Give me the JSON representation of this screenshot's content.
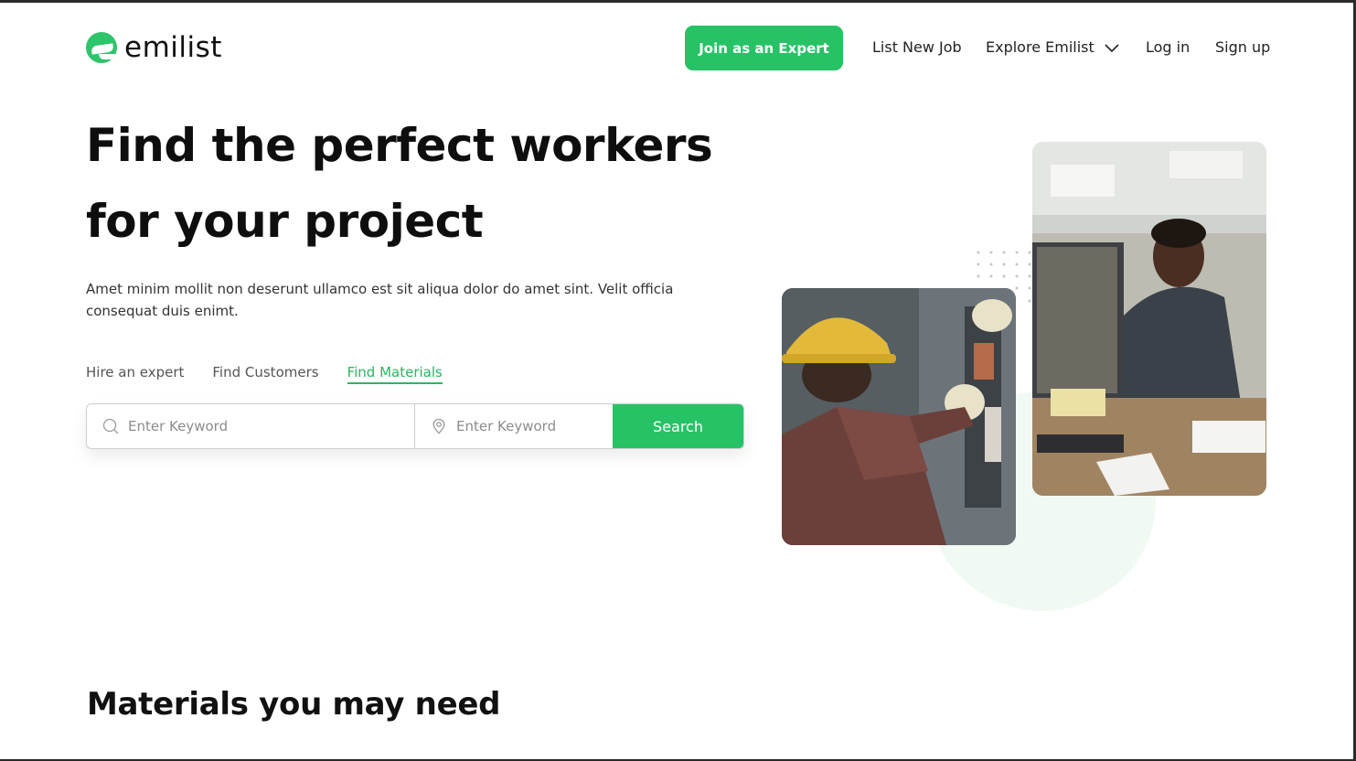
{
  "header": {
    "logo_text": "emilist",
    "join_label": "Join as an Expert",
    "nav": {
      "list_new_job": "List New Job",
      "explore": "Explore Emilist",
      "login": "Log in",
      "signup": "Sign up"
    }
  },
  "hero": {
    "title": "Find the perfect workers for your project",
    "description": "Amet minim mollit non deserunt ullamco est sit aliqua dolor do amet sint. Velit officia consequat duis enimt.",
    "tabs": [
      {
        "label": "Hire an expert",
        "active": false
      },
      {
        "label": "Find Customers",
        "active": false
      },
      {
        "label": "Find Materials",
        "active": true
      }
    ],
    "search": {
      "keyword_placeholder": "Enter Keyword",
      "location_placeholder": "Enter Keyword",
      "button_label": "Search"
    }
  },
  "materials": {
    "title": "Materials you may need"
  },
  "colors": {
    "accent": "#27c266",
    "accent_text": "#27b864",
    "deco_circle": "#f0faf3"
  },
  "icons": [
    "search-icon",
    "location-pin-icon",
    "chevron-down-icon"
  ]
}
